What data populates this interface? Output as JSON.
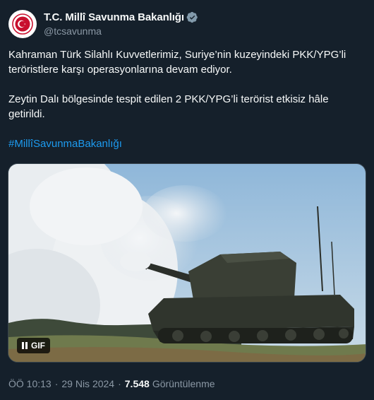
{
  "account": {
    "display_name": "T.C. Millî Savunma Bakanlığı",
    "handle": "@tcsavunma",
    "verified": true
  },
  "tweet": {
    "paragraph_1": "Kahraman Türk Silahlı Kuvvetlerimiz, Suriye’nin kuzeyindeki PKK/YPG’li teröristlere karşı operasyonlarına devam ediyor.",
    "paragraph_2": "Zeytin Dalı bölgesinde tespit edilen 2 PKK/YPG’li terörist etkisiz hâle getirildi.",
    "hashtag": "#MillîSavunmaBakanlığı"
  },
  "media": {
    "gif_label": "GIF",
    "pause_icon": "pause-icon"
  },
  "meta": {
    "time": "ÖÖ 10:13",
    "date": "29 Nis 2024",
    "separator": "·",
    "views_count": "7.548",
    "views_label": "Görüntülenme"
  },
  "colors": {
    "background": "#15202b",
    "text": "#f7f9f9",
    "secondary": "#8b98a5",
    "link": "#1d9bf0",
    "avatar_red": "#c8102e"
  }
}
